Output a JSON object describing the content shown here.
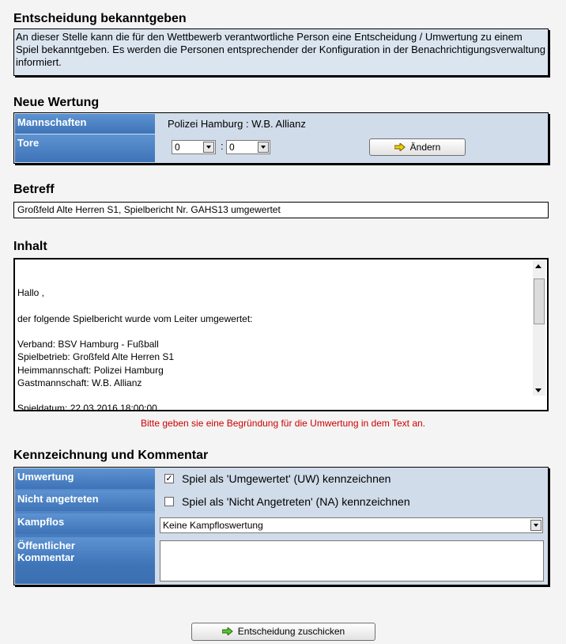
{
  "header": {
    "title": "Entscheidung bekanntgeben",
    "info": "An dieser Stelle kann die für den Wettbewerb verantwortliche Person eine Entscheidung / Umwertung zu einem Spiel bekanntgeben. Es werden die Personen entsprechender der Konfiguration in der Benachrichtigungsverwaltung informiert."
  },
  "neue_wertung": {
    "heading": "Neue Wertung",
    "mannschaften_label": "Mannschaften",
    "mannschaften_value": "Polizei Hamburg : W.B. Allianz",
    "tore_label": "Tore",
    "tore_home": "0",
    "tore_sep": ":",
    "tore_away": "0",
    "change_button": "Ändern"
  },
  "betreff": {
    "heading": "Betreff",
    "value": "Großfeld Alte Herren S1, Spielbericht Nr. GAHS13 umgewertet"
  },
  "inhalt": {
    "heading": "Inhalt",
    "text": "Hallo ,\n\nder folgende Spielbericht wurde vom Leiter umgewertet:\n\nVerband: BSV Hamburg - Fußball\nSpielbetrieb: Großfeld Alte Herren S1\nHeimmannschaft: Polizei Hamburg\nGastmannschaft: W.B. Allianz\n\nSpieldatum: 22.03.2016 18:00:00",
    "hint": "Bitte geben sie eine Begründung für die Umwertung in dem Text an."
  },
  "kennzeichnung": {
    "heading": "Kennzeichnung und Kommentar",
    "umwertung_label": "Umwertung",
    "umwertung_text": "Spiel als 'Umgewertet' (UW) kennzeichnen",
    "umwertung_checked": true,
    "nicht_label": "Nicht angetreten",
    "nicht_text": "Spiel als 'Nicht Angetreten' (NA) kennzeichnen",
    "nicht_checked": false,
    "kampflos_label": "Kampflos",
    "kampflos_value": "Keine Kampfloswertung",
    "kommentar_label_1": "Öffentlicher",
    "kommentar_label_2": "Kommentar"
  },
  "submit_button": "Entscheidung zuschicken",
  "colors": {
    "accent_label": "#3e74b8",
    "panel": "#d1dcea",
    "hint": "#cc0000",
    "arrow": "#f4d000"
  }
}
